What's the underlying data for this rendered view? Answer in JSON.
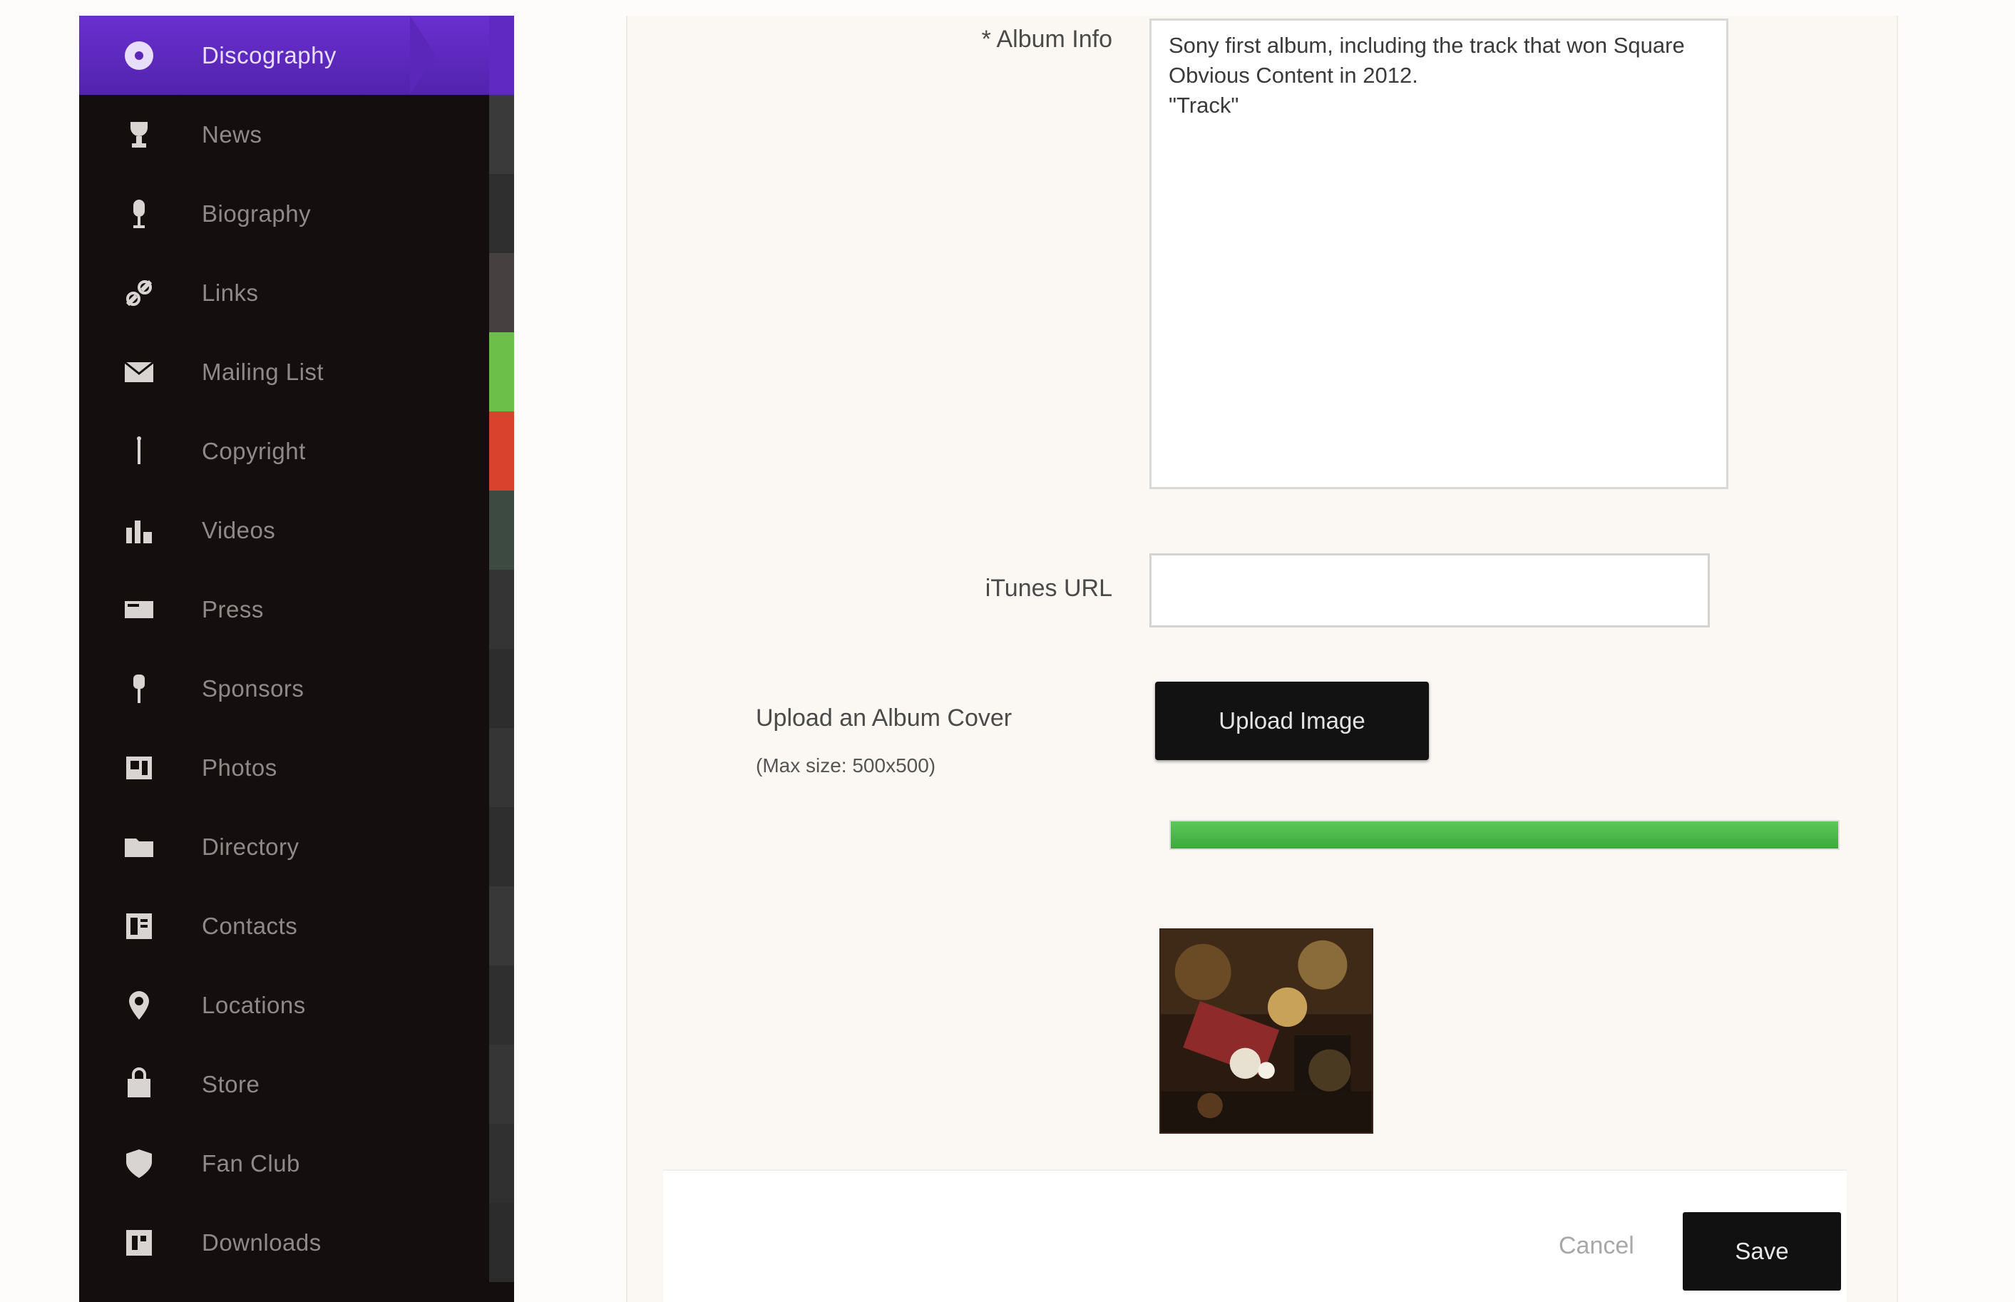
{
  "sidebar": {
    "items": [
      {
        "label": "Discography",
        "icon": "disc-icon",
        "active": true
      },
      {
        "label": "News",
        "icon": "trophy-icon"
      },
      {
        "label": "Biography",
        "icon": "microphone-icon"
      },
      {
        "label": "Links",
        "icon": "link-icon"
      },
      {
        "label": "Mailing List",
        "icon": "envelope-icon"
      },
      {
        "label": "Copyright",
        "icon": "info-icon"
      },
      {
        "label": "Videos",
        "icon": "chart-icon"
      },
      {
        "label": "Press",
        "icon": "newspaper-icon"
      },
      {
        "label": "Sponsors",
        "icon": "pin-icon"
      },
      {
        "label": "Photos",
        "icon": "photo-icon"
      },
      {
        "label": "Directory",
        "icon": "folder-icon"
      },
      {
        "label": "Contacts",
        "icon": "contacts-icon"
      },
      {
        "label": "Locations",
        "icon": "location-icon"
      },
      {
        "label": "Store",
        "icon": "bag-icon"
      },
      {
        "label": "Fan Club",
        "icon": "shield-icon"
      },
      {
        "label": "Downloads",
        "icon": "download-icon"
      }
    ],
    "status_colors": [
      "#2a2a2a",
      "#3a3a3a",
      "#2f2f2f",
      "#474040",
      "#6cc04a",
      "#d9432e",
      "#3c4a42",
      "#343434",
      "#2d2d2d",
      "#353535",
      "#2e2e2e",
      "#383838",
      "#2f2f2f",
      "#363636",
      "#303030",
      "#2c2c2c"
    ],
    "accent": "#5f29c2"
  },
  "form": {
    "description_label": "* Album Info",
    "description_value": "Sony first album, including the track that won Square Obvious Content in 2012.\n\"Track\"",
    "itunes_label": "iTunes URL",
    "itunes_value": "",
    "upload_label": "Upload an Album Cover",
    "upload_hint": "(Max size: 500x500)",
    "upload_button": "Upload Image",
    "upload_progress": 1.0,
    "cover_alt": "album-cover"
  },
  "footer": {
    "cancel_label": "Cancel",
    "save_label": "Save"
  }
}
